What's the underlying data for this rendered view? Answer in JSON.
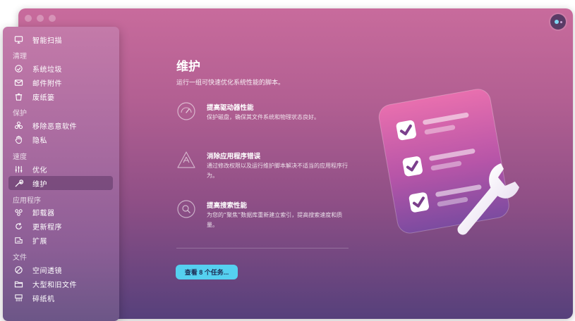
{
  "sidebar": {
    "top_item": {
      "label": "智能扫描",
      "icon": "monitor-icon"
    },
    "sections": [
      {
        "header": "清理",
        "items": [
          {
            "label": "系统垃圾",
            "icon": "trash-bin-icon"
          },
          {
            "label": "邮件附件",
            "icon": "mail-icon"
          },
          {
            "label": "废纸篓",
            "icon": "trash-icon"
          }
        ]
      },
      {
        "header": "保护",
        "items": [
          {
            "label": "移除恶意软件",
            "icon": "biohazard-icon"
          },
          {
            "label": "隐私",
            "icon": "hand-icon"
          }
        ]
      },
      {
        "header": "速度",
        "items": [
          {
            "label": "优化",
            "icon": "sliders-icon"
          },
          {
            "label": "维护",
            "icon": "wrench-icon",
            "active": true
          }
        ]
      },
      {
        "header": "应用程序",
        "items": [
          {
            "label": "卸载器",
            "icon": "uninstaller-icon"
          },
          {
            "label": "更新程序",
            "icon": "updater-icon"
          },
          {
            "label": "扩展",
            "icon": "extensions-icon"
          }
        ]
      },
      {
        "header": "文件",
        "items": [
          {
            "label": "空间透镜",
            "icon": "space-lens-icon"
          },
          {
            "label": "大型和旧文件",
            "icon": "folder-icon"
          },
          {
            "label": "碎纸机",
            "icon": "shredder-icon"
          }
        ]
      }
    ]
  },
  "main": {
    "title": "维护",
    "subtitle": "运行一组可快速优化系统性能的脚本。",
    "features": [
      {
        "title": "提高驱动器性能",
        "desc": "保护磁盘，确保其文件系统和物理状态良好。",
        "icon": "gauge-icon"
      },
      {
        "title": "消除应用程序错误",
        "desc": "通过修改权限以及运行维护脚本解决不适当的应用程序行为。",
        "icon": "app-store-icon"
      },
      {
        "title": "提高搜索性能",
        "desc": "为您的“聚焦”数据库重新建立索引，提高搜索速度和质量。",
        "icon": "magnifier-icon"
      }
    ],
    "cta_label": "查看 8 个任务..."
  },
  "colors": {
    "accent": "#55d0f0",
    "background_top": "#c86b9c",
    "background_bottom": "#56407b"
  },
  "illustration": "checklist-wrench-icon"
}
